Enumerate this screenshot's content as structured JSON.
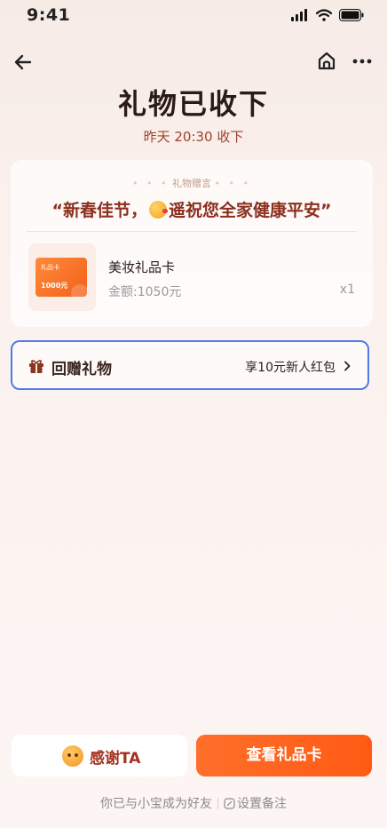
{
  "status": {
    "time": "9:41"
  },
  "header": {
    "title": "礼物已收下",
    "subtitle": "昨天 20:30 收下"
  },
  "gift": {
    "tag": "礼物赠言",
    "message_start": "“新春佳节，",
    "message_end": "遥祝您全家健康平安”",
    "card_label": "礼品卡",
    "card_amount": "1000元",
    "product_name": "美妆礼品卡",
    "product_price": "金额:1050元",
    "product_qty": "x1"
  },
  "return_gift": {
    "label": "回赠礼物",
    "promo": "享10元新人红包"
  },
  "actions": {
    "thank_label": "感谢TA",
    "view_label": "查看礼品卡"
  },
  "footer": {
    "friend_text": "你已与小宝成为好友",
    "remark_label": "设置备注"
  },
  "colors": {
    "accent": "#ff5a14",
    "title_red": "#8b2f1e",
    "highlight_border": "#4f7be8"
  },
  "icons": [
    "back-arrow-icon",
    "home-icon",
    "more-icon",
    "gift-icon",
    "chevron-right-icon",
    "edit-icon",
    "signal-icon",
    "wifi-icon",
    "battery-icon",
    "kiss-emoji-icon",
    "thank-avatar-icon"
  ]
}
